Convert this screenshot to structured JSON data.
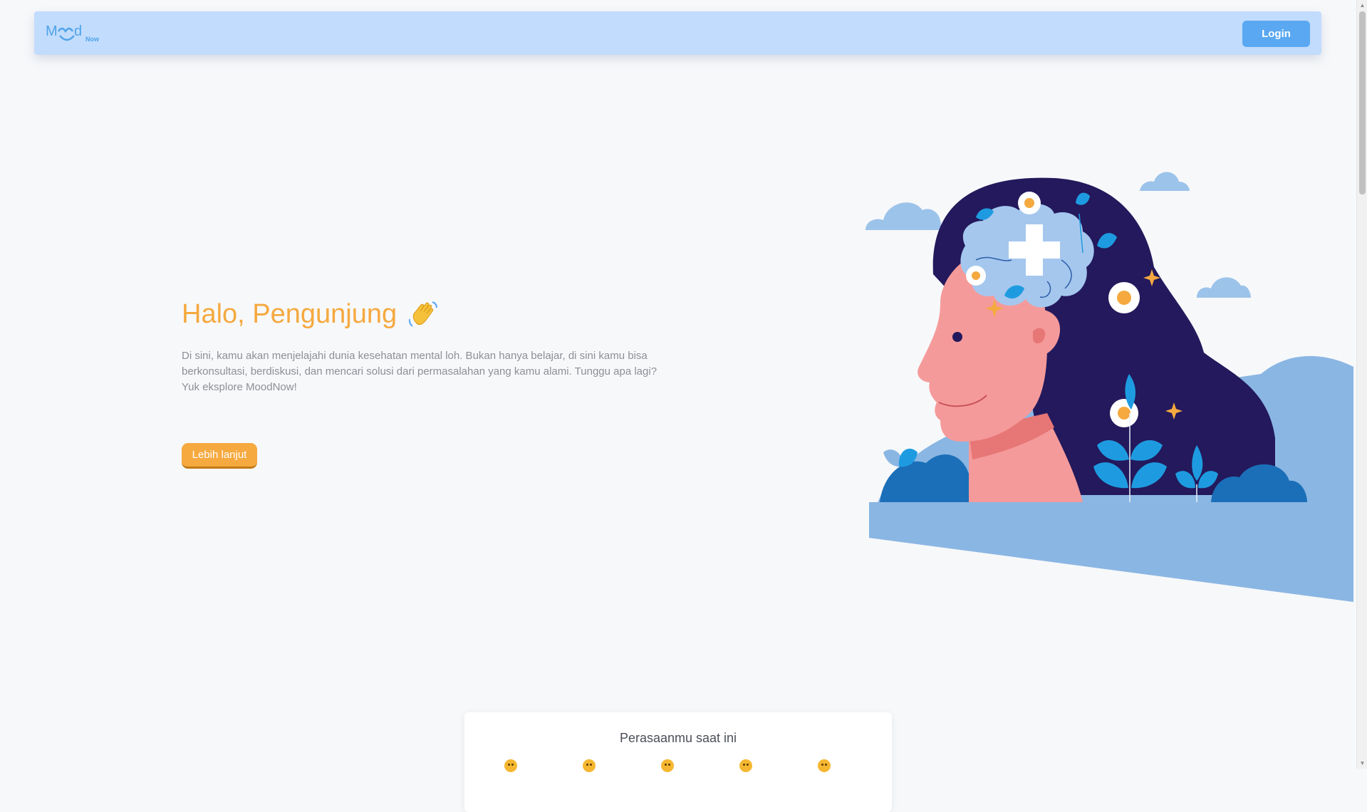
{
  "brand": {
    "logo_text": "Mood",
    "logo_sub": "Now",
    "accent": "#4fa3ea"
  },
  "navbar": {
    "login_label": "Login",
    "background": "#c2dcfd"
  },
  "hero": {
    "title": "Halo, Pengunjung",
    "title_icon": "waving-hand-icon",
    "description": "Di sini, kamu akan menjelajahi dunia kesehatan mental loh. Bukan hanya belajar, di sini kamu bisa berkonsultasi, berdiskusi, dan mencari solusi dari permasalahan yang kamu alami. Tunggu apa lagi? Yuk eksplore MoodNow!",
    "cta_label": "Lebih lanjut",
    "accent": "#f5a93f"
  },
  "mood": {
    "title": "Perasaanmu saat ini",
    "options": [
      "very-sad-emoji",
      "sad-emoji",
      "neutral-emoji",
      "happy-emoji",
      "very-happy-emoji"
    ]
  }
}
